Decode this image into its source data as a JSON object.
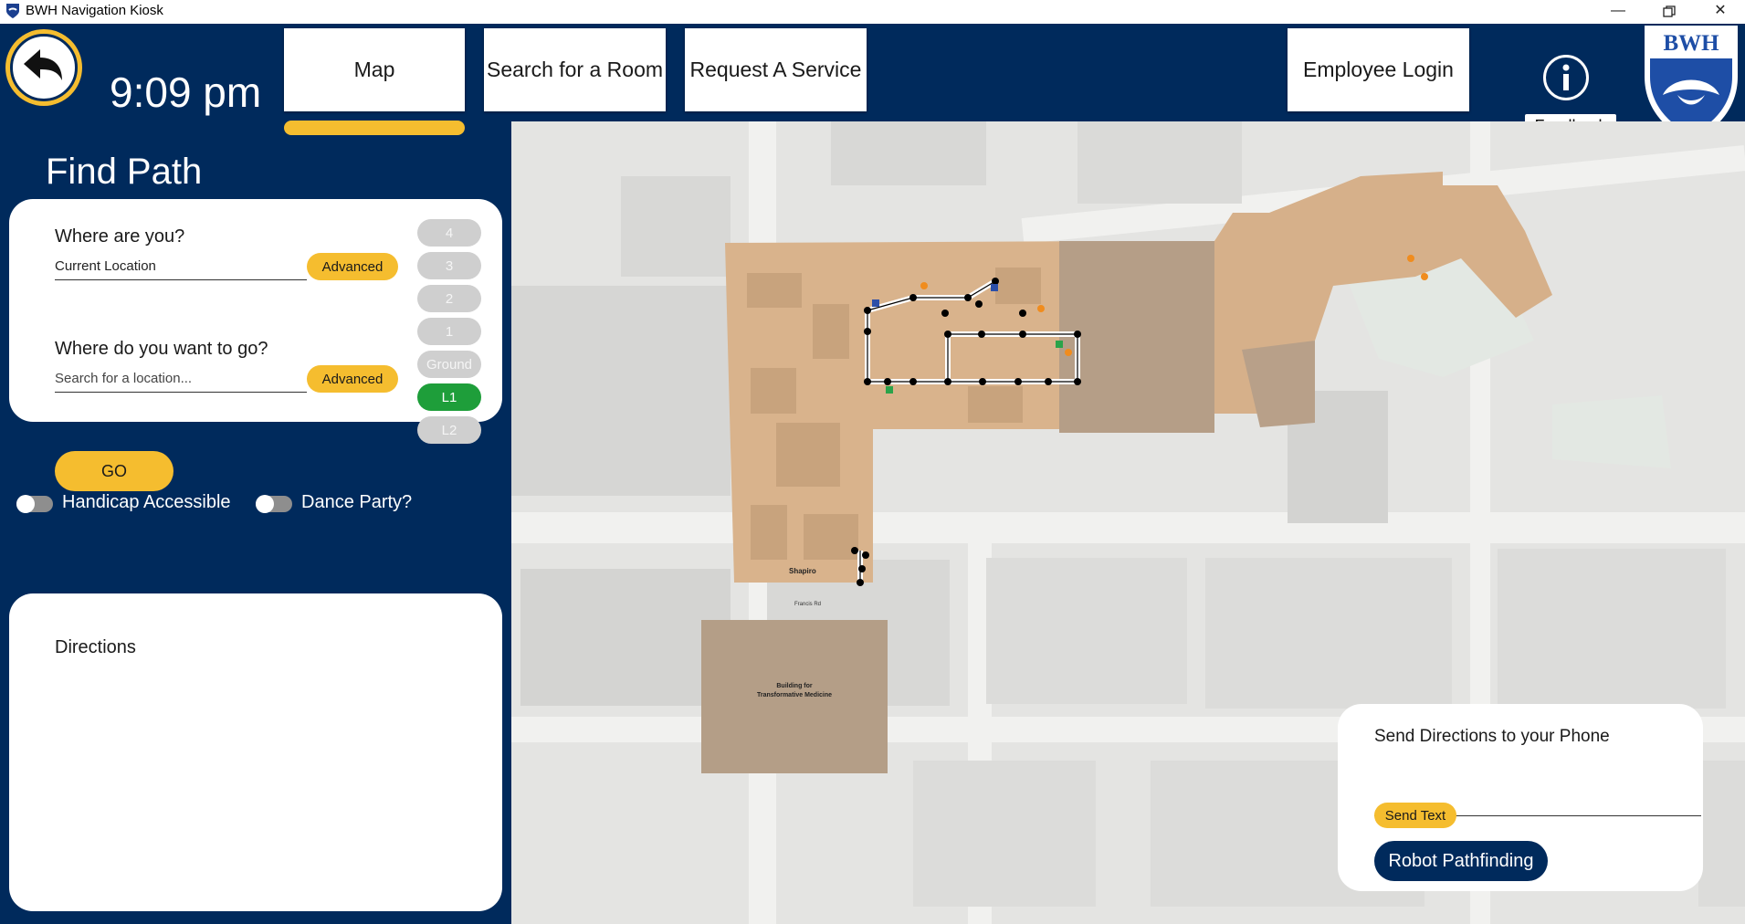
{
  "window": {
    "title": "BWH Navigation Kiosk",
    "minimize_icon": "minimize-icon",
    "restore_icon": "restore-icon",
    "close_icon": "close-icon"
  },
  "header": {
    "time": "9:09 pm",
    "nav": [
      "Map",
      "Search for a Room",
      "Request A Service",
      "Employee Login"
    ],
    "active_nav": "Map",
    "feedback_label": "Feedback",
    "logo_text": "BWH"
  },
  "find_path": {
    "title": "Find Path",
    "from_label": "Where are you?",
    "from_value": "Current Location",
    "to_label": "Where do you want to go?",
    "to_placeholder": "Search for a location...",
    "advanced_label": "Advanced",
    "go_label": "GO",
    "floors": [
      "4",
      "3",
      "2",
      "1",
      "Ground",
      "L1",
      "L2"
    ],
    "active_floor": "L1"
  },
  "toggles": {
    "handicap_label": "Handicap Accessible",
    "handicap_on": false,
    "dance_label": "Dance Party?",
    "dance_on": false
  },
  "directions": {
    "title": "Directions"
  },
  "map": {
    "shapiro_label": "Shapiro",
    "road_label": "Francis Rd",
    "btm_label_1": "Building for",
    "btm_label_2": "Transformative Medicine",
    "colors": {
      "background": "#e4e4e2",
      "building": "#d9b38c",
      "building_dark": "#b59e87",
      "path": "#ffffff",
      "node": "#000000"
    }
  },
  "send_directions": {
    "title": "Send Directions to your Phone",
    "phone_value": "",
    "send_text_label": "Send Text",
    "robot_label": "Robot Pathfinding"
  },
  "colors": {
    "navy": "#002a5c",
    "gold": "#f5bd2f",
    "green": "#1e9e3a",
    "floor_inactive": "#cfcfcf"
  }
}
